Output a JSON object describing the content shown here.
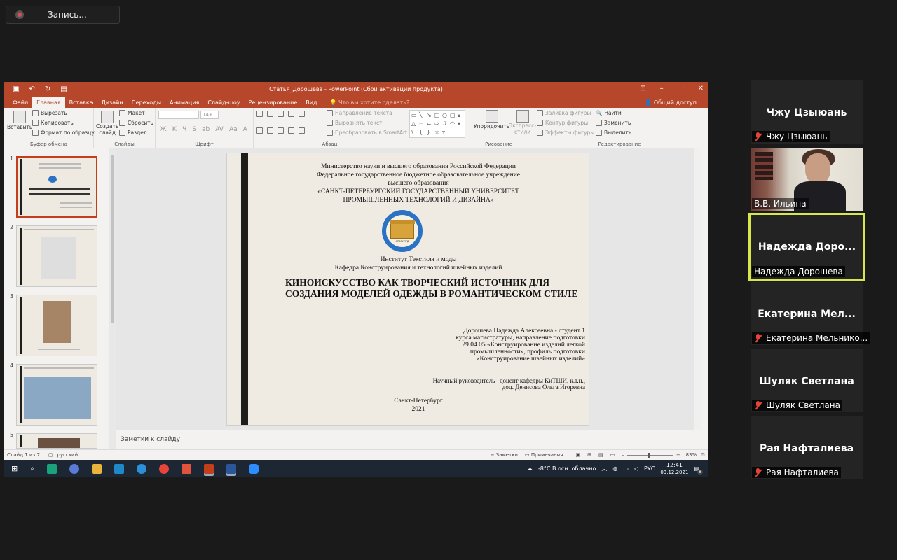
{
  "recording": {
    "label": "Запись..."
  },
  "ppt": {
    "window_title": "Статья_Дорошева - PowerPoint (Сбой активации продукта)",
    "tabs": [
      "Файл",
      "Главная",
      "Вставка",
      "Дизайн",
      "Переходы",
      "Анимация",
      "Слайд-шоу",
      "Рецензирование",
      "Вид"
    ],
    "help_search": "Что вы хотите сделать?",
    "share": "Общий доступ",
    "ribbon": {
      "clipboard": {
        "paste": "Вставить",
        "cut": "Вырезать",
        "copy": "Копировать",
        "format_painter": "Формат по образцу",
        "label": "Буфер обмена"
      },
      "slides": {
        "new_slide_1": "Создать",
        "new_slide_2": "слайд",
        "layout": "Макет",
        "reset": "Сбросить",
        "section": "Раздел",
        "label": "Слайды"
      },
      "font": {
        "size": "14+",
        "label": "Шрифт"
      },
      "paragraph": {
        "text_direction": "Направление текста",
        "align_text": "Выровнять текст",
        "smartart": "Преобразовать в SmartArt",
        "label": "Абзац"
      },
      "drawing": {
        "arrange": "Упорядочить",
        "quick_styles_1": "Экспресс-",
        "quick_styles_2": "стили",
        "fill": "Заливка фигуры",
        "outline": "Контур фигуры",
        "effects": "Эффекты фигуры",
        "label": "Рисование"
      },
      "editing": {
        "find": "Найти",
        "replace": "Заменить",
        "select": "Выделить",
        "label": "Редактирование"
      }
    },
    "thumbs": [
      "1",
      "2",
      "3",
      "4",
      "5"
    ],
    "slide": {
      "line1": "Министерство науки и высшего образования Российской Федерации",
      "line2": "Федеральное государственное бюджетное образовательное учреждение",
      "line3": "высшего образования",
      "line4": "«САНКТ-ПЕТЕРБУРГСКИЙ ГОСУДАРСТВЕННЫЙ УНИВЕРСИТЕТ",
      "line5": "ПРОМЫШЛЕННЫХ ТЕХНОЛОГИЙ И ДИЗАЙНА»",
      "logo_text": "СПбГУПТД",
      "institute": "Институт Текстиля и моды",
      "department": "Кафедра Конструирования и технологий швейных изделий",
      "title": "КИНОИСКУССТВО КАК ТВОРЧЕСКИЙ ИСТОЧНИК ДЛЯ СОЗДАНИЯ МОДЕЛЕЙ ОДЕЖДЫ В РОМАНТИЧЕСКОМ СТИЛЕ",
      "author_1": "Дорошева Надежда Алексеевна - студент 1",
      "author_2": "курса магистратуры, направление подготовки",
      "author_3": "29.04.05 «Конструирование изделий легкой",
      "author_4": "промышленности», профиль подготовки",
      "author_5": "«Конструирование швейных изделий»",
      "advisor_1": "Научный руководитель– доцент кафедры КиТШИ, к.т.н.,",
      "advisor_2": "доц. Денисова Ольга Игоревна",
      "city": "Санкт-Петербург",
      "year": "2021"
    },
    "notes_placeholder": "Заметки к слайду",
    "status": {
      "slide_info": "Слайд 1 из 7",
      "language": "русский",
      "notes": "Заметки",
      "comments": "Примечания",
      "zoom": "83%"
    },
    "taskbar": {
      "weather": "-8°C  В осн. облачно",
      "lang": "РУС",
      "time": "12:41",
      "date": "03.12.2021",
      "notif": "8"
    }
  },
  "participants": [
    {
      "display": "Чжу Цзыюань",
      "label": "Чжу Цзыюань",
      "muted": true
    },
    {
      "display": "",
      "label": "В.В. Ильина",
      "muted": false,
      "video": true
    },
    {
      "display": "Надежда  Доро...",
      "label": "Надежда Дорошева",
      "muted": false,
      "active": true
    },
    {
      "display": "Екатерина  Мел...",
      "label": "Екатерина Мельнико...",
      "muted": true
    },
    {
      "display": "Шуляк Светлана",
      "label": "Шуляк Светлана",
      "muted": true
    },
    {
      "display": "Рая Нафталиева",
      "label": "Рая Нафталиева",
      "muted": true
    }
  ],
  "colors": {
    "ppt_accent": "#b7472a",
    "active_speaker": "#d6e64b",
    "muted_icon": "#e3443a"
  }
}
